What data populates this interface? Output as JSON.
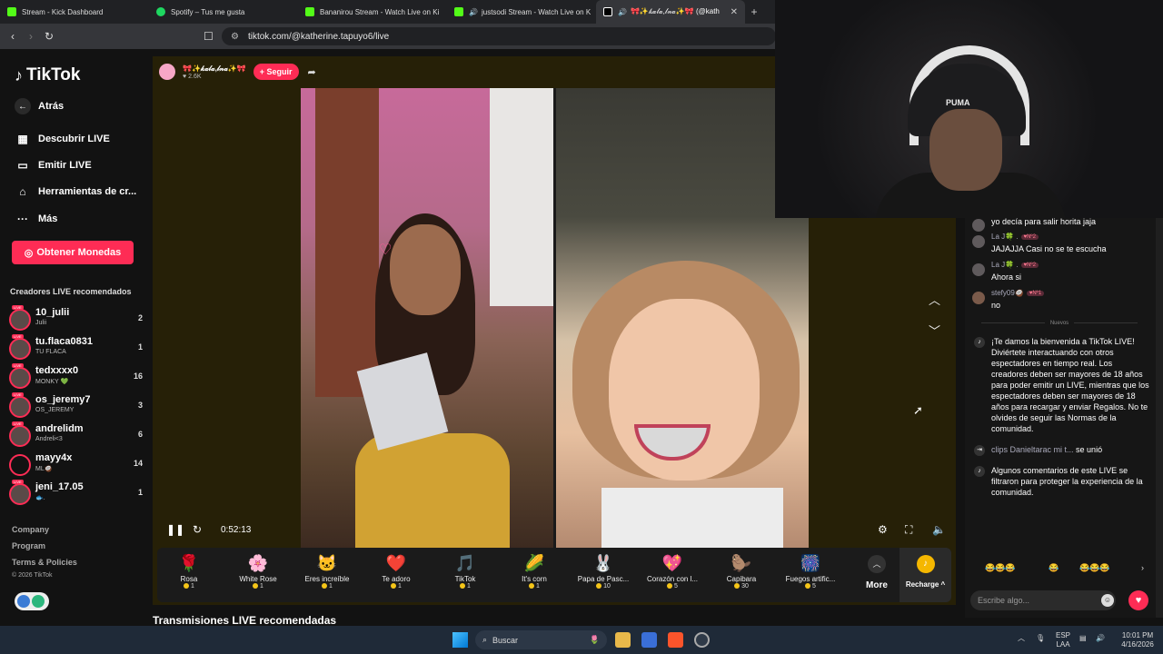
{
  "browser": {
    "tabs": [
      {
        "label": "Stream - Kick Dashboard",
        "color": "#53fc18"
      },
      {
        "label": "Spotify – Tus me gusta",
        "color": "#1ed760"
      },
      {
        "label": "Bananirou Stream - Watch Live on Ki",
        "color": "#53fc18"
      },
      {
        "label": "justsodi Stream - Watch Live on K",
        "color": "#53fc18"
      },
      {
        "label": "🎀✨𝓀𝒶𝓁𝒶,𝓁𝓃𝒶✨🎀 (@kath",
        "color": "#ffffff"
      }
    ],
    "new_tab": "+",
    "url": "tiktok.com/@katherine.tapuyo6/live"
  },
  "sidebar": {
    "logo": "TikTok",
    "back": "Atrás",
    "nav": [
      {
        "label": "Descubrir LIVE",
        "icon": "calendar-icon"
      },
      {
        "label": "Emitir LIVE",
        "icon": "camera-icon"
      },
      {
        "label": "Herramientas de cr...",
        "icon": "home-icon"
      },
      {
        "label": "Más",
        "icon": "more-icon"
      }
    ],
    "coins_button": "Obtener Monedas",
    "recommended_heading": "Creadores LIVE recomendados",
    "creators": [
      {
        "name": "10_julii",
        "sub": "Julii",
        "count": "2"
      },
      {
        "name": "tu.flaca0831",
        "sub": "TU FLACA",
        "count": "1"
      },
      {
        "name": "tedxxxx0",
        "sub": "MONKY 💚",
        "count": "16"
      },
      {
        "name": "os_jeremy7",
        "sub": "OS_JEREMY",
        "count": "3"
      },
      {
        "name": "andrelidm",
        "sub": "Andreli<3",
        "count": "6"
      },
      {
        "name": "mayy4x",
        "sub": "ML🥥",
        "count": "14"
      },
      {
        "name": "jeni_17.05",
        "sub": "🐟.",
        "count": "1"
      }
    ],
    "footer": [
      "Company",
      "Program",
      "Terms & Policies"
    ],
    "copyright": "© 2026 TikTok"
  },
  "player": {
    "streamer_name": "🎀✨𝓀𝒶𝓁𝒶,𝓁𝓃𝒶✨🎀",
    "likes": "♥ 2.6K",
    "follow": "+ Seguir",
    "time": "0:52:13",
    "gifts": [
      {
        "name": "Rosa",
        "price": "1",
        "icon": "🌹"
      },
      {
        "name": "White Rose",
        "price": "1",
        "icon": "🌸"
      },
      {
        "name": "Eres increíble",
        "price": "1",
        "icon": "🐱"
      },
      {
        "name": "Te adoro",
        "price": "1",
        "icon": "❤️"
      },
      {
        "name": "TikTok",
        "price": "1",
        "icon": "🎵"
      },
      {
        "name": "It's corn",
        "price": "1",
        "icon": "🌽"
      },
      {
        "name": "Papa de Pasc...",
        "price": "10",
        "icon": "🐰"
      },
      {
        "name": "Corazón con l...",
        "price": "5",
        "icon": "💖"
      },
      {
        "name": "Capibara",
        "price": "30",
        "icon": "🦫"
      },
      {
        "name": "Fuegos artific...",
        "price": "5",
        "icon": "🎆"
      }
    ],
    "more": "More",
    "recharge": "Recharge ^",
    "recommended_section": "Transmisiones LIVE recomendadas"
  },
  "cam": {
    "cap_text": "PUMA"
  },
  "chat": {
    "messages": [
      {
        "user": "",
        "badge": "",
        "text": "yo decía para salir horita jaja"
      },
      {
        "user": "La J🍀 .",
        "badge": "♥Nº2",
        "text": "JAJAJJA Casi no se te escucha"
      },
      {
        "user": "La J🍀 .",
        "badge": "♥Nº2",
        "text": "Ahora si"
      },
      {
        "user": "stefy09🥥",
        "badge": "♥Nº1",
        "text": "no"
      }
    ],
    "new_label": "Nuevos",
    "welcome": "¡Te damos la bienvenida a TikTok LIVE! Diviértete interactuando con otros espectadores en tiempo real. Los creadores deben ser mayores de 18 años para poder emitir un LIVE, mientras que los espectadores deben ser mayores de 18 años para recargar y enviar Regalos. No te olvides de seguir las Normas de la comunidad.",
    "joined_user": "clips Danieltarac mi t...",
    "joined_text": "se unió",
    "filtered": "Algunos comentarios de este LIVE se filtraron para proteger la experiencia de la comunidad.",
    "emojis": [
      "😂😂😂",
      "😂",
      "😂😂😂"
    ],
    "input_placeholder": "Escribe algo..."
  },
  "taskbar": {
    "search": "Buscar",
    "lang": "ESP",
    "lang2": "LAA",
    "time": "10:01 PM",
    "date": "4/16/2026"
  }
}
